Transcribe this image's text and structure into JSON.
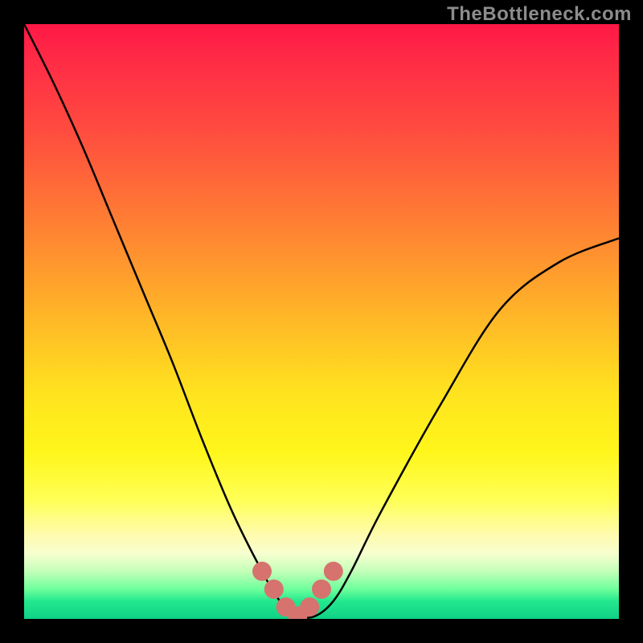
{
  "attribution": "TheBottleneck.com",
  "chart_data": {
    "type": "line",
    "title": "",
    "xlabel": "",
    "ylabel": "",
    "xlim": [
      0,
      100
    ],
    "ylim": [
      0,
      100
    ],
    "series": [
      {
        "name": "bottleneck-curve",
        "x": [
          0,
          5,
          10,
          15,
          20,
          25,
          30,
          35,
          40,
          43,
          46,
          49,
          52,
          55,
          60,
          70,
          80,
          90,
          100
        ],
        "values": [
          100,
          90,
          79,
          67,
          55,
          43,
          30,
          18,
          8,
          3,
          0.5,
          0.5,
          3,
          8,
          18,
          36,
          52,
          60,
          64
        ]
      }
    ],
    "markers": {
      "name": "optimum-points",
      "x": [
        40,
        42,
        44,
        46,
        48,
        50,
        52
      ],
      "values": [
        8,
        5,
        2,
        0.5,
        2,
        5,
        8
      ],
      "color": "#d6736e",
      "radius_px": 12
    },
    "background": "vertical-gradient-red-to-green"
  }
}
